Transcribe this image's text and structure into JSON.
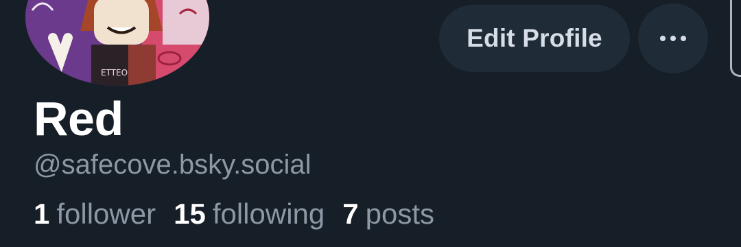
{
  "profile": {
    "display_name": "Red",
    "handle": "@safecove.bsky.social",
    "avatar_icon": "cartoon-avatar-icon"
  },
  "actions": {
    "edit_profile_label": "Edit Profile",
    "more_icon": "more-dots-icon"
  },
  "stats": [
    {
      "count": "1",
      "label": "follower"
    },
    {
      "count": "15",
      "label": "following"
    },
    {
      "count": "7",
      "label": "posts"
    }
  ],
  "colors": {
    "background": "#161e27",
    "button_bg": "#1f2b37",
    "text_primary": "#ffffff",
    "text_secondary": "#8d98a6"
  }
}
